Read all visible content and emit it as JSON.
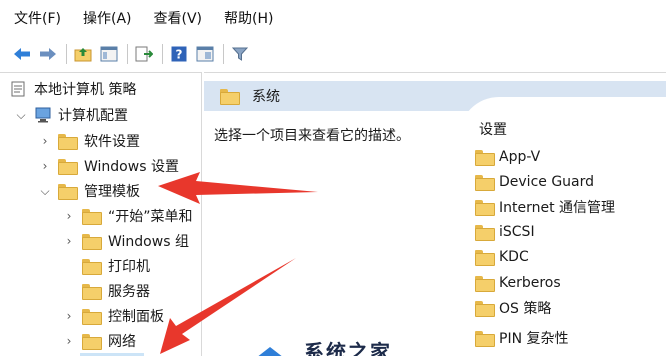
{
  "menubar": {
    "items": [
      "文件(F)",
      "操作(A)",
      "查看(V)",
      "帮助(H)"
    ]
  },
  "toolbar": {
    "buttons": [
      "back-arrow-icon",
      "forward-arrow-icon",
      "up-folder-icon",
      "show-hide-tree-icon",
      "export-list-icon",
      "help-icon",
      "properties-icon",
      "filter-icon"
    ]
  },
  "tree": {
    "root_label": "本地计算机 策略",
    "computer_config": "计算机配置",
    "software_settings": "软件设置",
    "windows_settings": "Windows 设置",
    "admin_templates": "管理模板",
    "start_menu": "“开始”菜单和",
    "windows_components": "Windows 组",
    "printers": "打印机",
    "servers": "服务器",
    "control_panel": "控制面板",
    "network": "网络"
  },
  "right": {
    "header_title": "系统",
    "description": "选择一个项目来查看它的描述。",
    "settings_title": "设置",
    "items": [
      "App-V",
      "Device Guard",
      "Internet 通信管理",
      "iSCSI",
      "KDC",
      "Kerberos",
      "OS 策略",
      "PIN 复杂性"
    ]
  },
  "watermark": {
    "text": "系统之家"
  },
  "colors": {
    "header_bg": "#d8e4f2",
    "arrow": "#e8372c",
    "folder": "#f5cf6a"
  }
}
